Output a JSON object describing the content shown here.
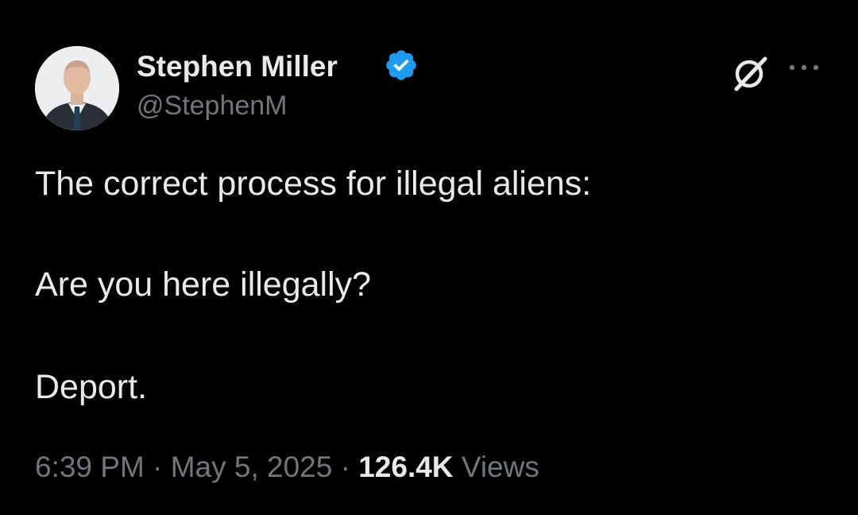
{
  "author": {
    "name": "Stephen Miller",
    "handle": "@StephenM",
    "verified": true,
    "verified_color": "#1d9bf0"
  },
  "tweet": {
    "lines": [
      "The correct process for illegal aliens:",
      "Are you here illegally?",
      "Deport."
    ]
  },
  "meta": {
    "time": "6:39 PM",
    "separator": "·",
    "date": "May 5, 2025",
    "views_count": "126.4K",
    "views_label": "Views"
  },
  "icons": {
    "grok": "grok-icon",
    "more": "more-options-icon"
  },
  "colors": {
    "background": "#000000",
    "primary_text": "#e7e9ea",
    "secondary_text": "#71767b"
  }
}
